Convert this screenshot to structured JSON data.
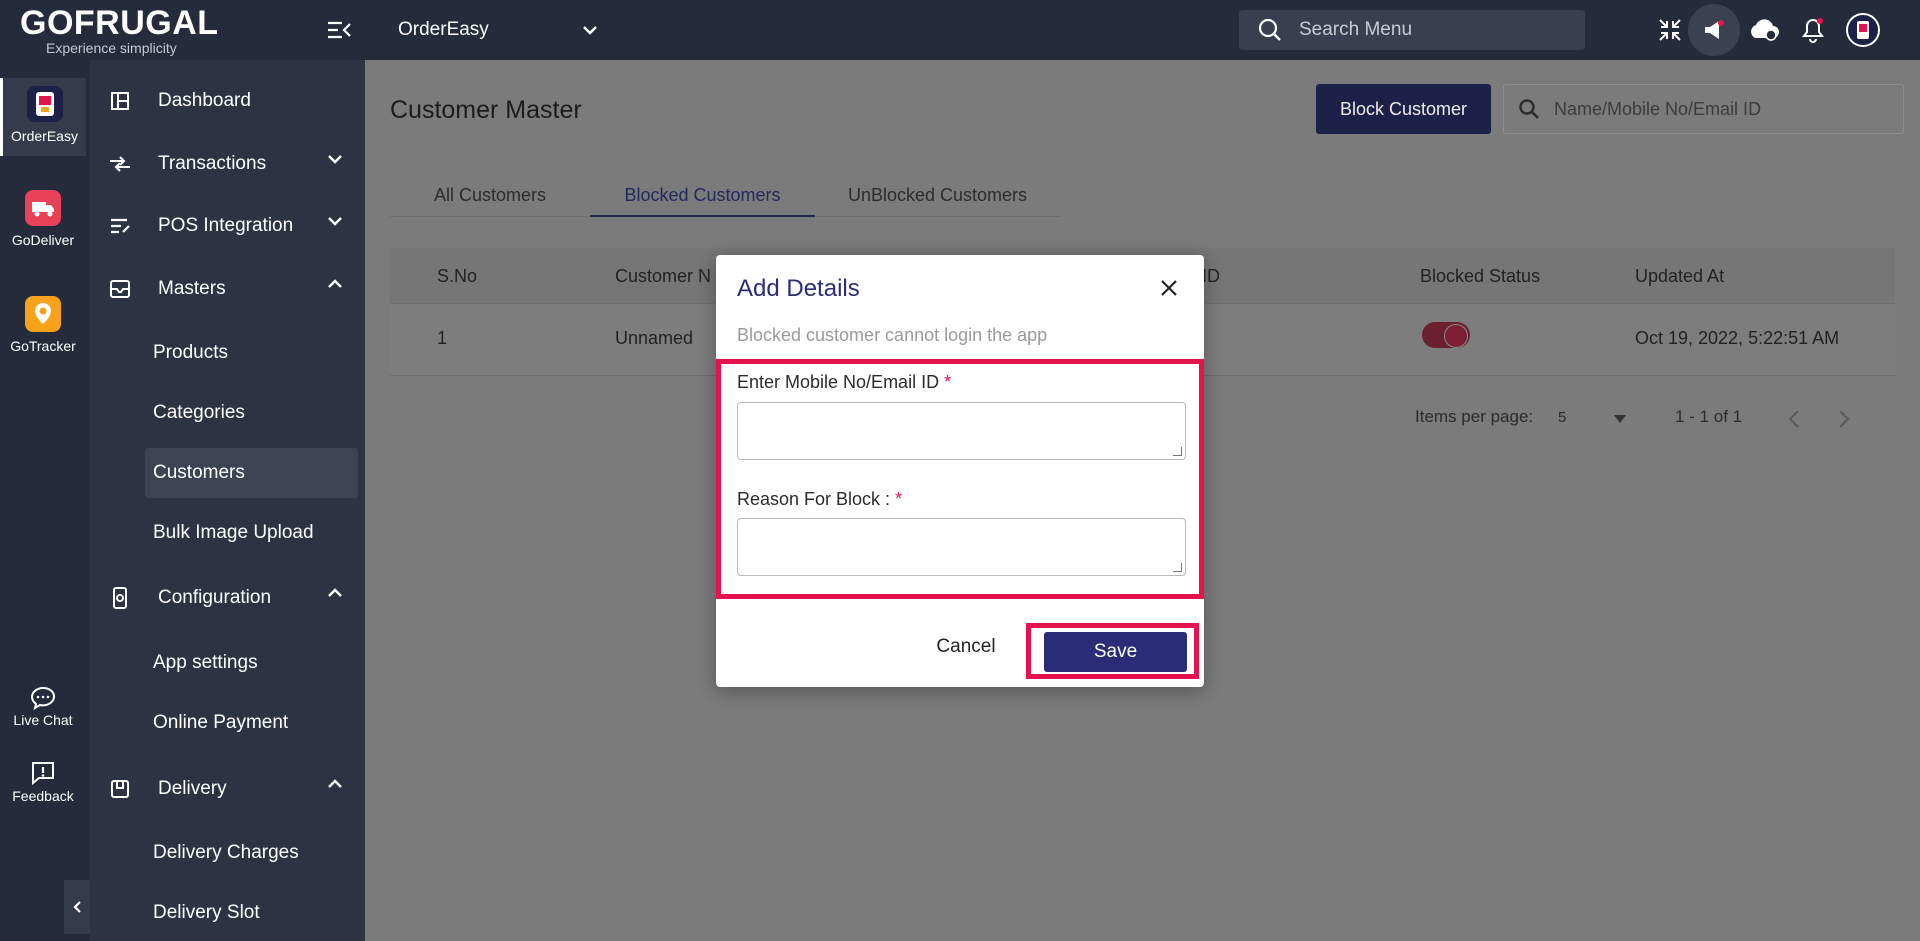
{
  "header": {
    "logo_text": "GOFRUGAL",
    "logo_tagline": "Experience simplicity",
    "app_selector": "OrderEasy",
    "search_placeholder": "Search Menu"
  },
  "rail": {
    "apps": [
      {
        "label": "OrderEasy"
      },
      {
        "label": "GoDeliver"
      },
      {
        "label": "GoTracker"
      }
    ],
    "live_chat": "Live Chat",
    "feedback": "Feedback"
  },
  "sidebar": {
    "dashboard": "Dashboard",
    "transactions": "Transactions",
    "pos_integration": "POS Integration",
    "masters": "Masters",
    "products": "Products",
    "categories": "Categories",
    "customers": "Customers",
    "bulk_image_upload": "Bulk Image Upload",
    "configuration": "Configuration",
    "app_settings": "App settings",
    "online_payment": "Online Payment",
    "delivery": "Delivery",
    "delivery_charges": "Delivery Charges",
    "delivery_slot": "Delivery Slot"
  },
  "main": {
    "title": "Customer Master",
    "block_button": "Block Customer",
    "search_placeholder": "Name/Mobile No/Email ID",
    "tabs": [
      "All Customers",
      "Blocked Customers",
      "UnBlocked Customers"
    ],
    "columns": {
      "sno": "S.No",
      "customer_name": "Customer N",
      "id": "ID",
      "blocked_status": "Blocked Status",
      "updated_at": "Updated At"
    },
    "row": {
      "sno": "1",
      "name": "Unnamed",
      "updated_at": "Oct 19, 2022, 5:22:51 AM"
    },
    "paginator": {
      "items_per_page_label": "Items per page:",
      "items_per_page": "5",
      "range": "1 - 1 of 1"
    }
  },
  "dialog": {
    "title": "Add Details",
    "subtitle": "Blocked customer cannot login the app",
    "mobile_label": "Enter Mobile No/Email ID",
    "reason_label": "Reason For Block :",
    "required_mark": "*",
    "cancel": "Cancel",
    "save": "Save"
  },
  "colors": {
    "topbar": "#262b3c",
    "sidebar": "#2e3344",
    "primary": "#2a2c78",
    "highlight": "#e4134f"
  }
}
